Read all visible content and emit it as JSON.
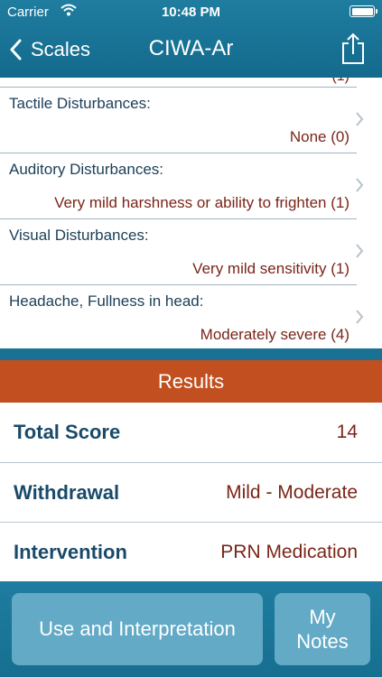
{
  "status_bar": {
    "carrier": "Carrier",
    "time": "10:48 PM"
  },
  "nav": {
    "back_label": "Scales",
    "title": "CIWA-Ar",
    "share_icon": "share-icon"
  },
  "scale_items": [
    {
      "label": "Tactile Disturbances:",
      "value": "None (0)"
    },
    {
      "label": "Auditory Disturbances:",
      "value": "Very mild harshness or ability to frighten (1)"
    },
    {
      "label": "Visual Disturbances:",
      "value": "Very mild sensitivity (1)"
    },
    {
      "label": "Headache, Fullness in head:",
      "value": "Moderately severe (4)"
    }
  ],
  "results": {
    "header": "Results",
    "rows": [
      {
        "label": "Total Score",
        "value": "14"
      },
      {
        "label": "Withdrawal",
        "value": "Mild - Moderate"
      },
      {
        "label": "Intervention",
        "value": "PRN Medication"
      }
    ]
  },
  "footer": {
    "use_button": "Use and Interpretation",
    "notes_button_line1": "My",
    "notes_button_line2": "Notes"
  },
  "colors": {
    "nav_bar": "#1f7da0",
    "results_header": "#c14f1f",
    "value_text": "#7a2518",
    "label_text": "#1a4a6a",
    "button": "#63aac6"
  }
}
